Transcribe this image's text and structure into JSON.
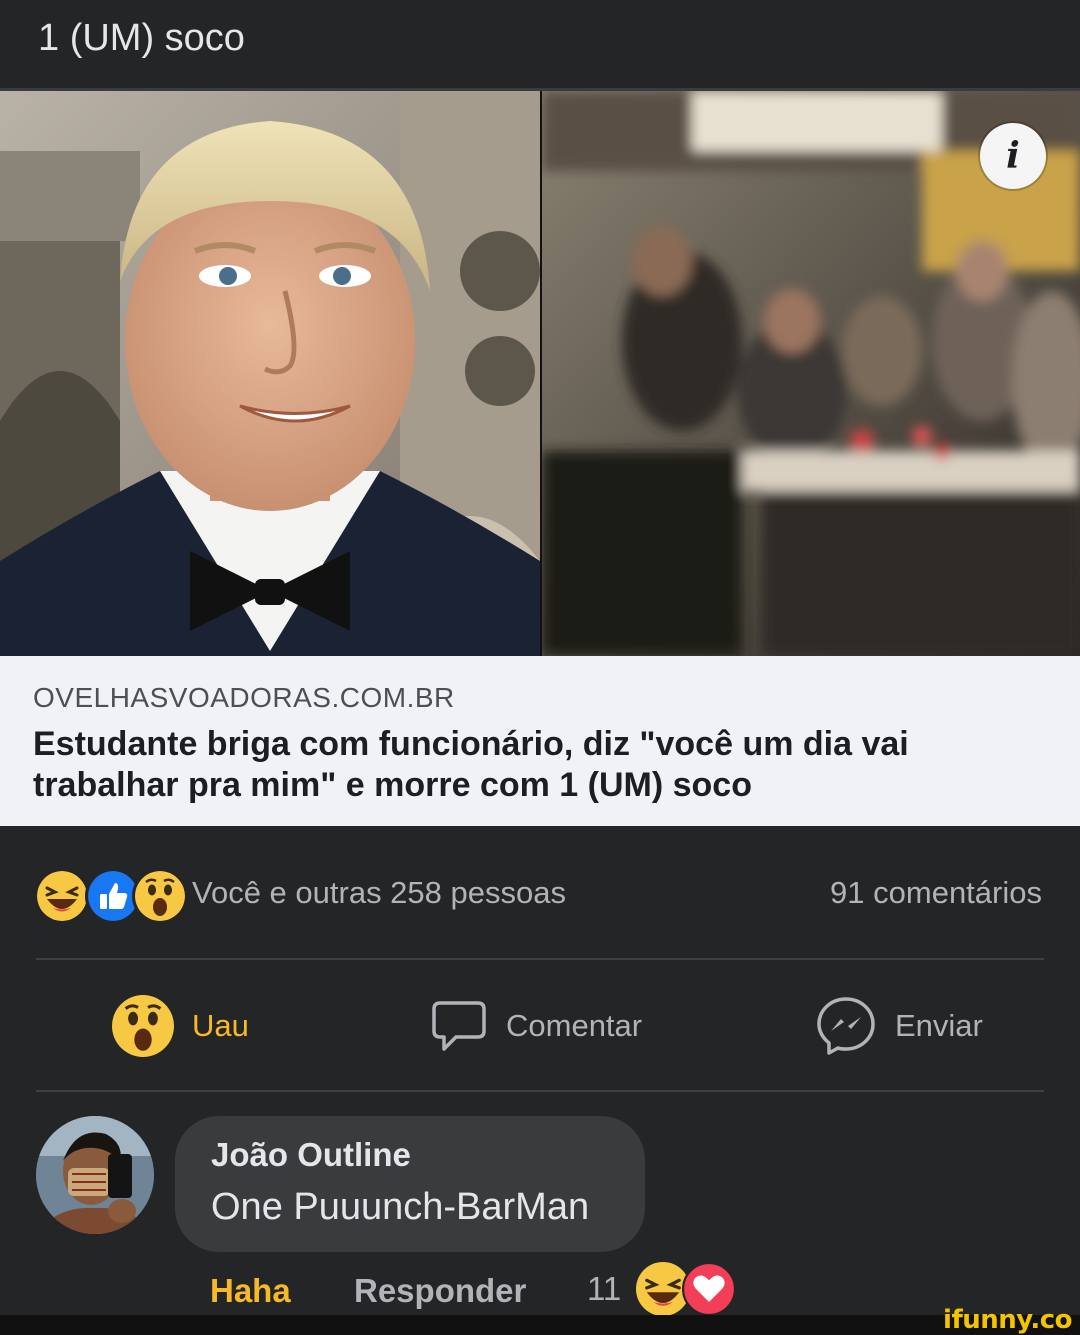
{
  "post": {
    "text": "1 (UM) soco"
  },
  "link_preview": {
    "domain": "OVELHASVOADORAS.COM.BR",
    "headline": "Estudante briga com funcionário, diz \"você um dia vai trabalhar pra mim\" e morre com 1 (UM) soco",
    "info_icon": "i"
  },
  "reactions": {
    "icons": [
      "haha-emoji",
      "like-emoji",
      "wow-emoji"
    ],
    "summary": "Você e outras 258 pessoas",
    "comments": "91 comentários"
  },
  "actions": {
    "reaction_label": "Uau",
    "comment_label": "Comentar",
    "send_label": "Enviar"
  },
  "comment": {
    "author": "João Outline",
    "text": "One Puuunch-BarMan",
    "haha_label": "Haha",
    "reply_label": "Responder",
    "reaction_count": "11",
    "reaction_icons": [
      "haha-emoji",
      "love-emoji"
    ]
  },
  "watermark": "ifunny.co",
  "colors": {
    "background": "#242526",
    "card": "#f0f2f5",
    "haha_active": "#f7b928",
    "secondary_text": "#b0b3b8"
  }
}
